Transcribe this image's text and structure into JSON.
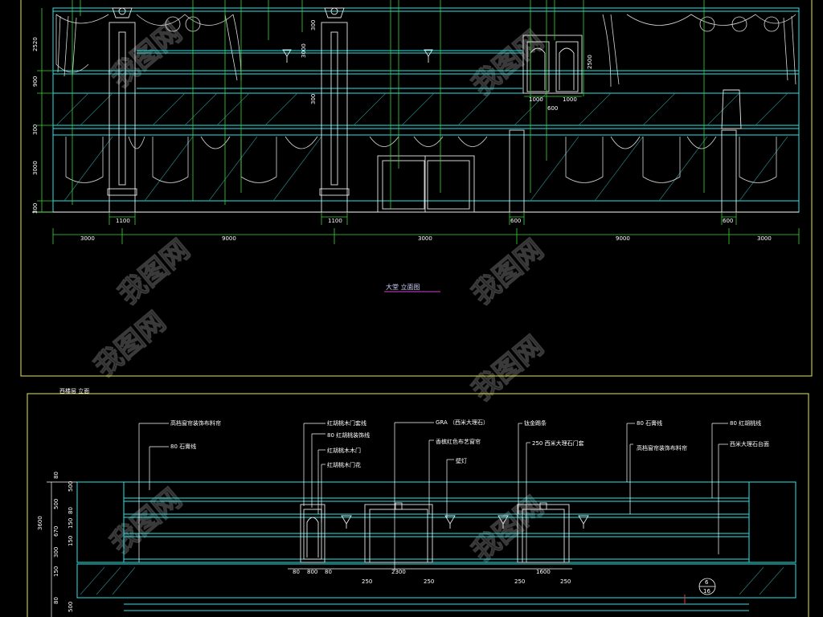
{
  "upper_drawing": {
    "title": "大堂 立面图",
    "horizontal_dims": [
      "3000",
      "9000",
      "3000",
      "9000",
      "3000"
    ],
    "column_width_dims": [
      "1100",
      "1100",
      "600",
      "600"
    ],
    "vertical_dims": [
      "2520",
      "900",
      "300",
      "3000",
      "300"
    ],
    "inner_dims": [
      "300",
      "3000",
      "300",
      "2500"
    ],
    "door_dims": [
      "1000",
      "1000",
      "600"
    ]
  },
  "lower_drawing": {
    "title": "西楼层 立面",
    "callouts_left": [
      "高档窗帘装饰布料帘",
      "80 石膏线"
    ],
    "callouts_mid1": [
      "红胡桃木门套线",
      "80 红胡桃装饰线",
      "红胡桃木木门",
      "红胡桃木门花"
    ],
    "callouts_mid2": [
      "GRA （西米大理石）",
      "香槟红色布艺窗帘"
    ],
    "callouts_mid3": [
      "壁灯"
    ],
    "callouts_mid4": [
      "钛金踢条",
      "250 西米大理石门套"
    ],
    "callouts_right1": [
      "80 石膏线",
      "高档窗帘装饰布料帘"
    ],
    "callouts_right2": [
      "80 红胡桃线",
      "西米大理石台面"
    ],
    "bottom_dims": [
      "80",
      "800",
      "80",
      "250",
      "2300",
      "250",
      "250",
      "1600",
      "250"
    ],
    "left_dims": [
      "80",
      "500",
      "500",
      "80",
      "150",
      "670",
      "150",
      "300",
      "150",
      "80",
      "500"
    ],
    "total_height": "3600",
    "detail_mark_top": "6",
    "detail_mark_bottom": "16"
  },
  "watermark": "我图网"
}
